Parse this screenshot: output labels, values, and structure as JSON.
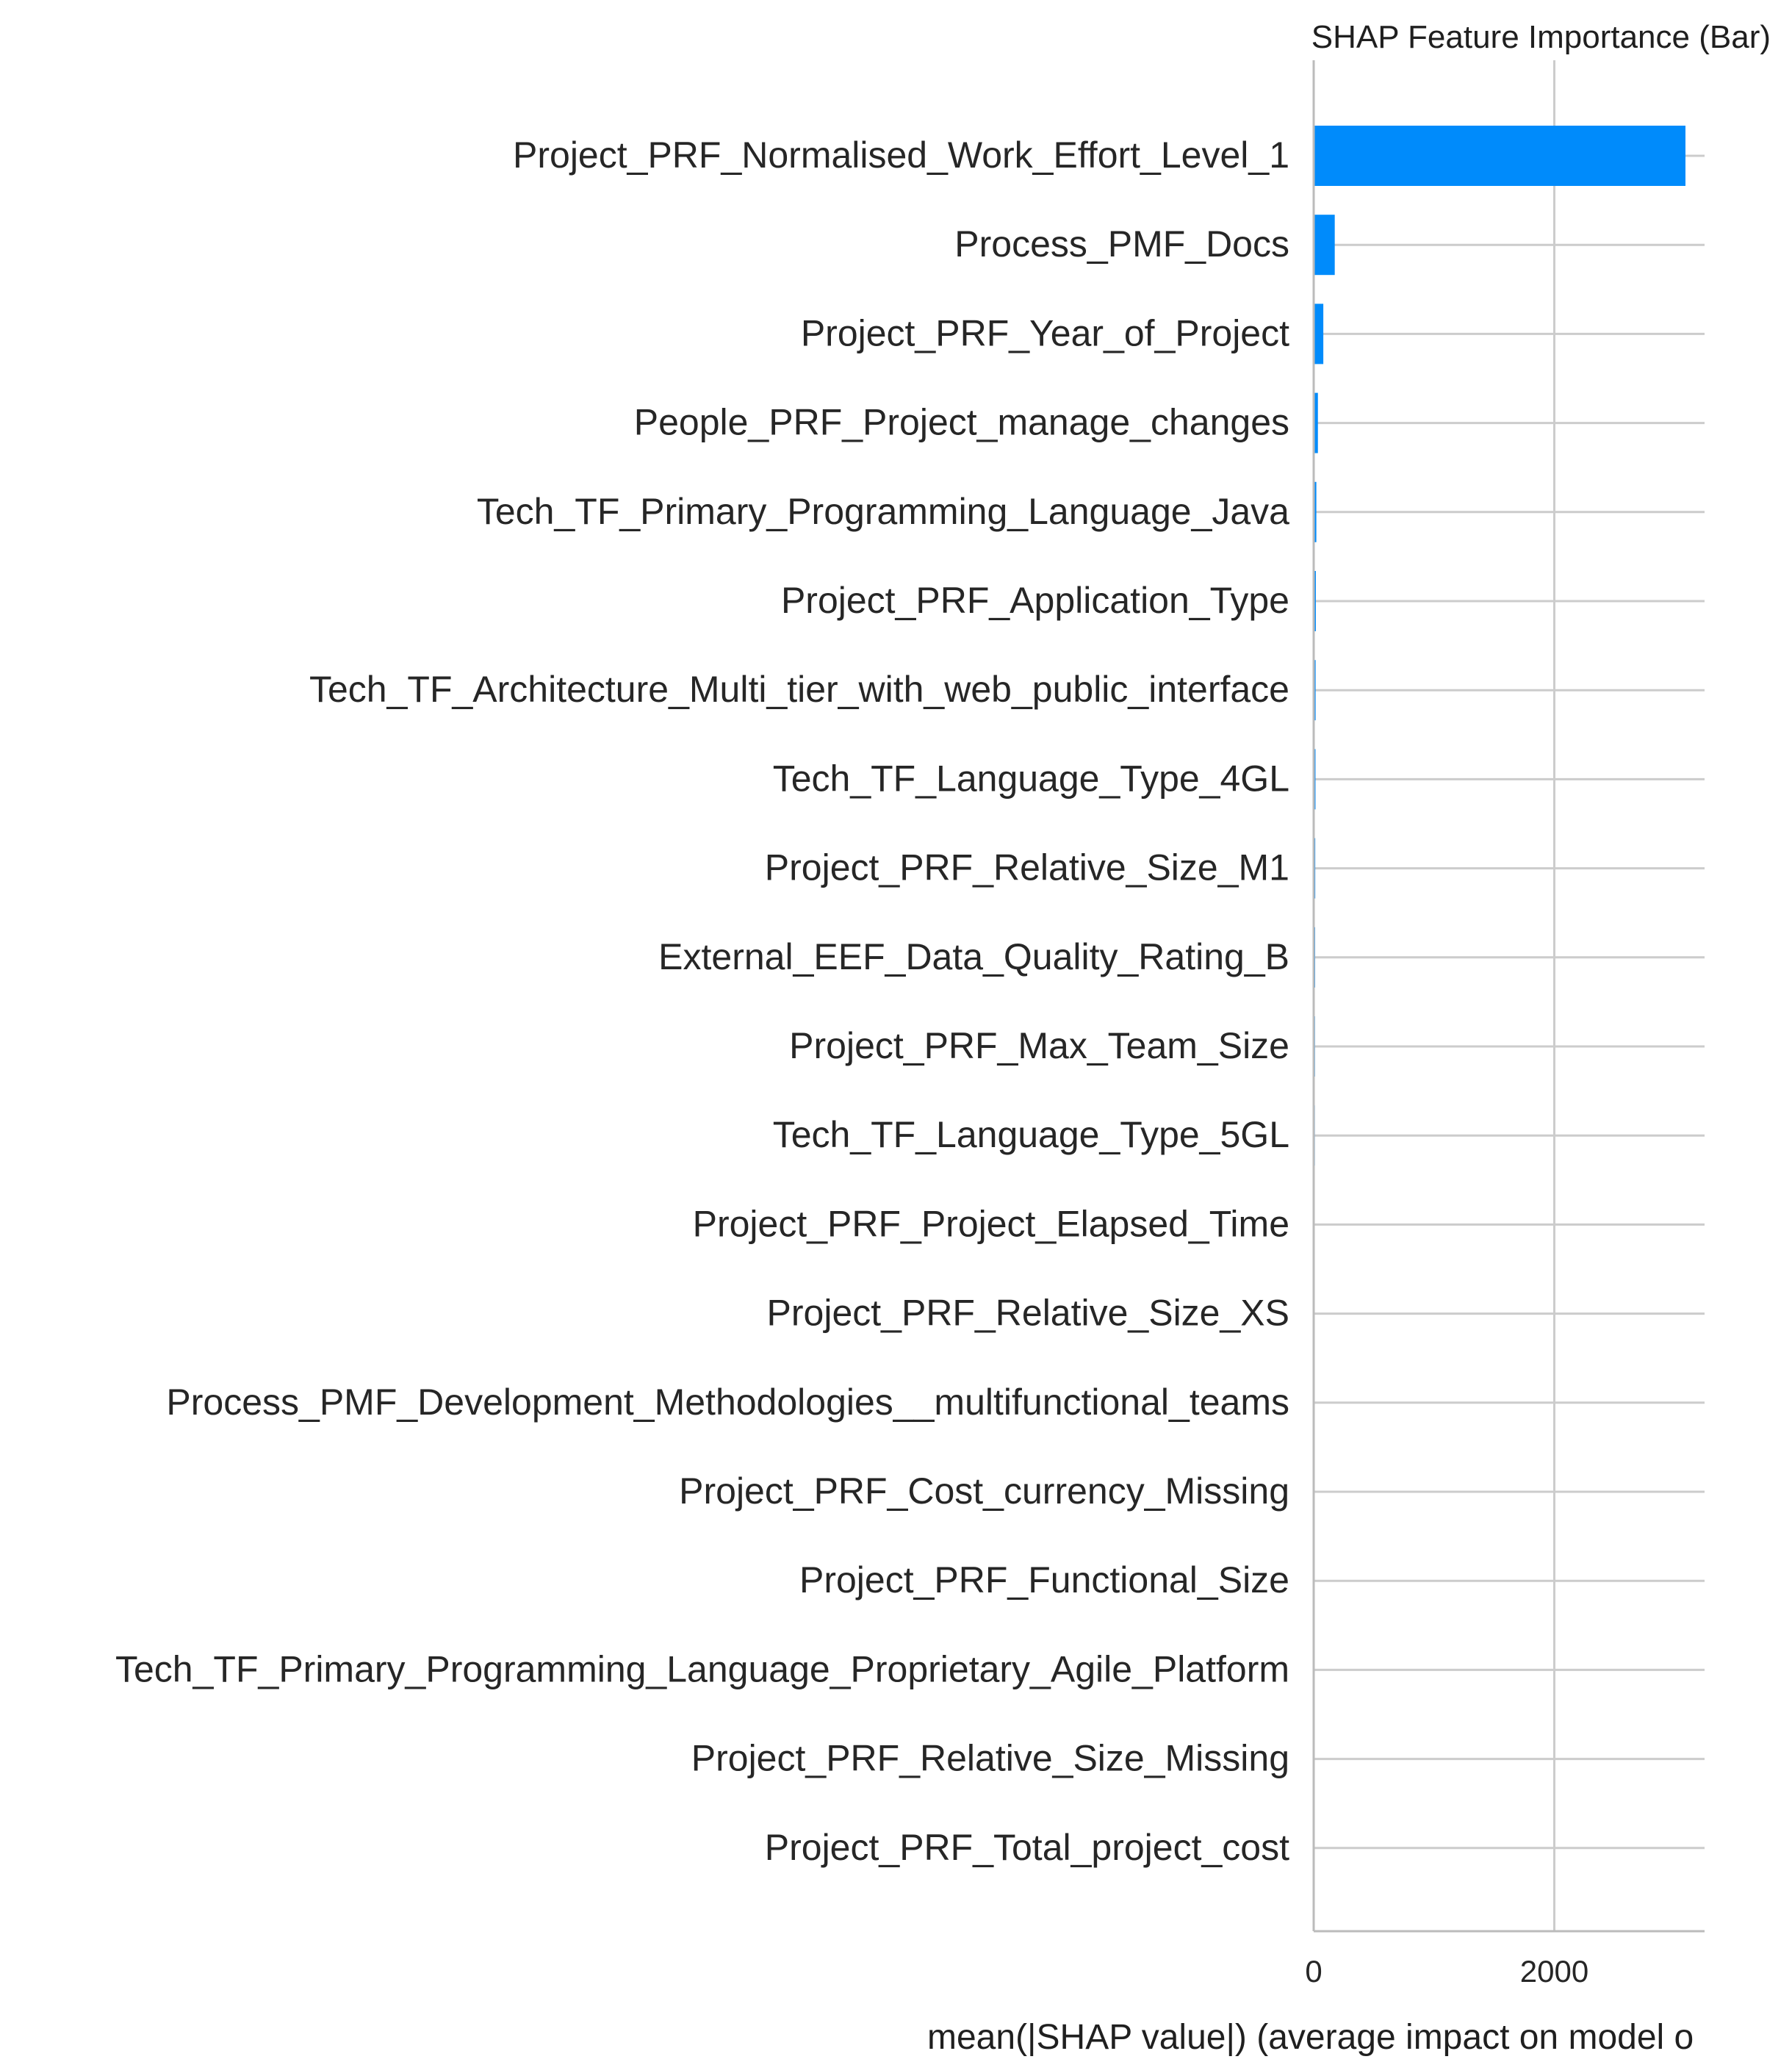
{
  "chart_data": {
    "type": "bar",
    "orientation": "horizontal",
    "title": "SHAP Feature Importance (Bar)",
    "xlabel": "mean(|SHAP value|) (average impact on model o",
    "ylabel": "",
    "xlim": [
      0,
      3300
    ],
    "xticks": [
      0,
      2000
    ],
    "xtick_labels": [
      "0",
      "2000"
    ],
    "grid": "vertical lines on x ticks, horizontal lines on each category",
    "bar_color": "#008bfb",
    "categories": [
      "Project_PRF_Normalised_Work_Effort_Level_1",
      "Process_PMF_Docs",
      "Project_PRF_Year_of_Project",
      "People_PRF_Project_manage_changes",
      "Tech_TF_Primary_Programming_Language_Java",
      "Project_PRF_Application_Type",
      "Tech_TF_Architecture_Multi_tier_with_web_public_interface",
      "Tech_TF_Language_Type_4GL",
      "Project_PRF_Relative_Size_M1",
      "External_EEF_Data_Quality_Rating_B",
      "Project_PRF_Max_Team_Size",
      "Tech_TF_Language_Type_5GL",
      "Project_PRF_Project_Elapsed_Time",
      "Project_PRF_Relative_Size_XS",
      "Process_PMF_Development_Methodologies__multifunctional_teams",
      "Project_PRF_Cost_currency_Missing",
      "Project_PRF_Functional_Size",
      "Tech_TF_Primary_Programming_Language_Proprietary_Agile_Platform",
      "Project_PRF_Relative_Size_Missing",
      "Project_PRF_Total_project_cost"
    ],
    "values": [
      3090,
      175,
      80,
      35,
      22,
      18,
      16,
      15,
      13,
      12,
      11,
      10,
      9,
      7,
      6,
      5,
      4,
      3,
      2,
      1
    ]
  }
}
